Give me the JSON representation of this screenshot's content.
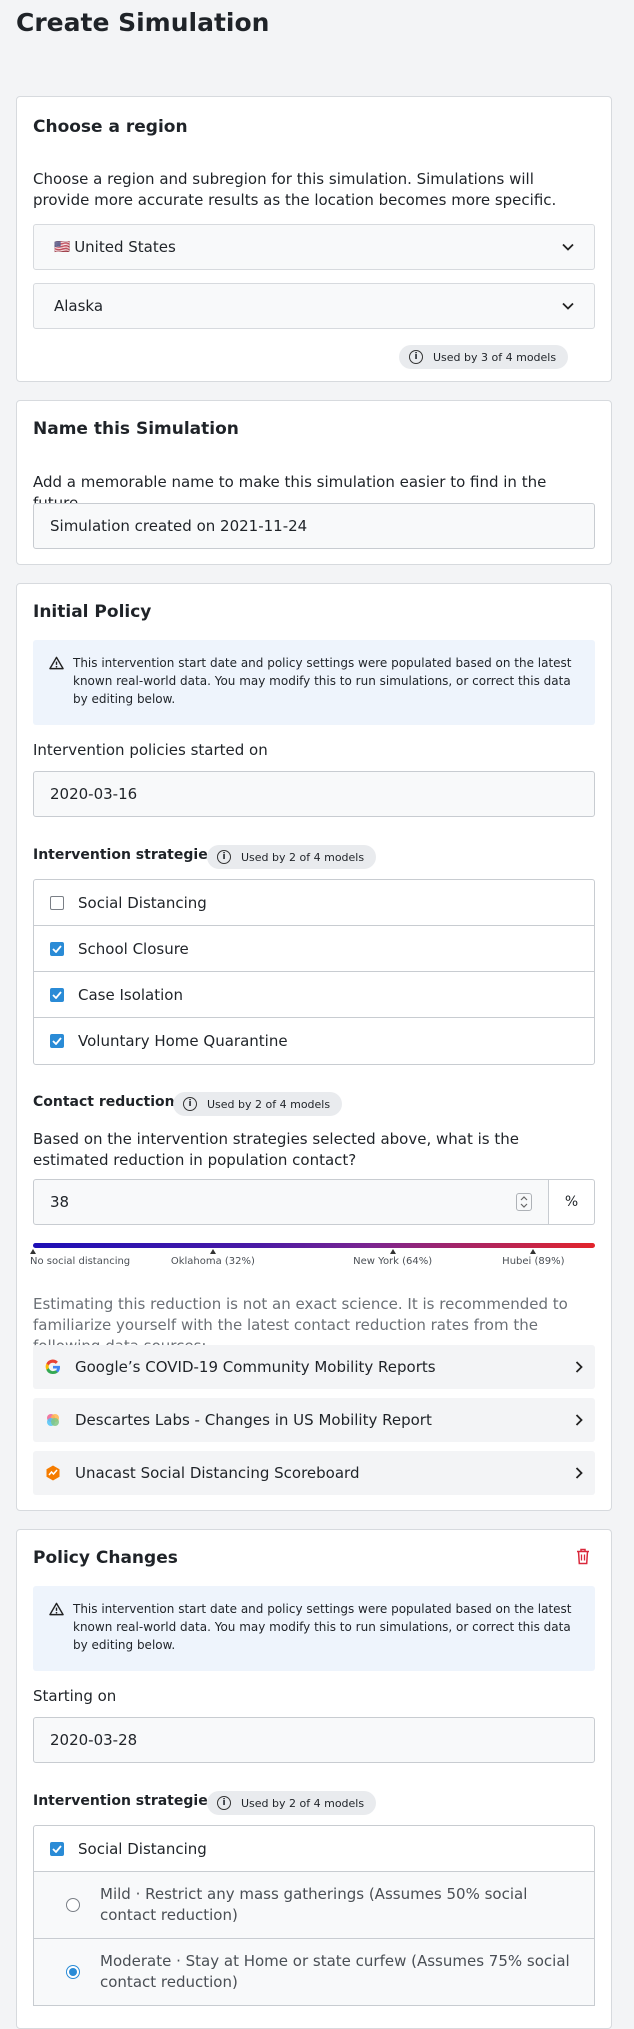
{
  "page": {
    "title": "Create Simulation"
  },
  "region": {
    "title": "Choose a region",
    "description": "Choose a region and subregion for this simulation. Simulations will provide more accurate results as the location becomes more specific.",
    "country": {
      "flag": "🇺🇸",
      "value": "United States"
    },
    "subregion": {
      "value": "Alaska"
    },
    "badge": "Used by 3 of 4 models"
  },
  "name": {
    "title": "Name this Simulation",
    "description": "Add a memorable name to make this simulation easier to find in the future.",
    "value": "Simulation created on 2021-11-24"
  },
  "initial_policy": {
    "title": "Initial Policy",
    "notice": "This intervention start date and policy settings were populated based on the latest known real-world data. You may modify this to run simulations, or correct this data by editing below.",
    "start_label": "Intervention policies started on",
    "start_value": "2020-03-16",
    "strategies_label": "Intervention strategies",
    "strategies_badge": "Used by 2 of 4 models",
    "strategies": [
      {
        "label": "Social Distancing",
        "checked": false
      },
      {
        "label": "School Closure",
        "checked": true
      },
      {
        "label": "Case Isolation",
        "checked": true
      },
      {
        "label": "Voluntary Home Quarantine",
        "checked": true
      }
    ],
    "contact_label": "Contact reduction",
    "contact_badge": "Used by 2 of 4 models",
    "contact_question": "Based on the intervention strategies selected above, what is the estimated reduction in population contact?",
    "contact_value": "38",
    "contact_unit": "%",
    "spectrum_markers": [
      {
        "label": "No social distancing",
        "value": 0
      },
      {
        "label": "Oklahoma (32%)",
        "value": 32
      },
      {
        "label": "New York (64%)",
        "value": 64
      },
      {
        "label": "Hubei (89%)",
        "value": 89
      }
    ],
    "estimate_note": "Estimating this reduction is not an exact science. It is recommended to familiarize yourself with the latest contact reduction rates from the following data sources:",
    "sources": [
      {
        "label": "Google’s COVID-19 Community Mobility Reports",
        "icon": "google-icon"
      },
      {
        "label": "Descartes Labs - Changes in US Mobility Report",
        "icon": "descartes-labs-icon"
      },
      {
        "label": "Unacast Social Distancing Scoreboard",
        "icon": "unacast-icon"
      }
    ]
  },
  "policy_changes": {
    "title": "Policy Changes",
    "notice": "This intervention start date and policy settings were populated based on the latest known real-world data. You may modify this to run simulations, or correct this data by editing below.",
    "start_label": "Starting on",
    "start_value": "2020-03-28",
    "strategies_label": "Intervention strategies",
    "strategies_badge": "Used by 2 of 4 models",
    "social_distancing": {
      "label": "Social Distancing",
      "checked": true
    },
    "levels": [
      {
        "label": "Mild · Restrict any mass gatherings (Assumes 50% social contact reduction)",
        "selected": false
      },
      {
        "label": "Moderate · Stay at Home or state curfew (Assumes 75% social contact reduction)",
        "selected": true
      }
    ]
  },
  "colors": {
    "accent": "#2a8bd6",
    "danger": "#d9283b",
    "notice_bg": "#eef4fc"
  }
}
